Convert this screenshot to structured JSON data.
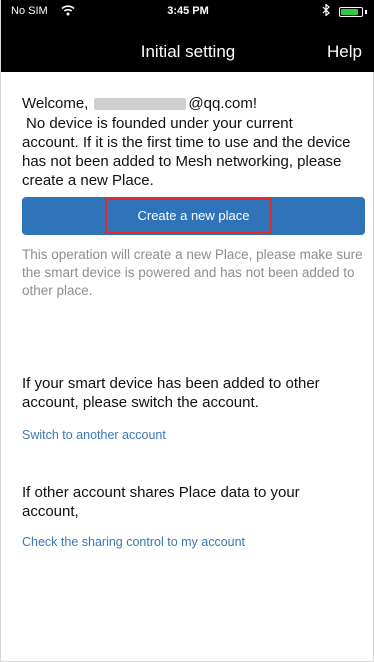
{
  "status_bar": {
    "carrier": "No SIM",
    "time": "3:45 PM",
    "battery_level": 0.85
  },
  "nav": {
    "title": "Initial setting",
    "help_label": "Help"
  },
  "welcome": {
    "prefix": "Welcome,",
    "email_suffix": "@qq.com!"
  },
  "notice": {
    "first_line": "No device is founded under your current",
    "rest": "account. If it is the first time to use and the device has not been added to Mesh networking, please create a new Place."
  },
  "create_button": {
    "label": "Create a new place",
    "color": "#2f73b8"
  },
  "highlight_color": "#e22a2a",
  "operation_description": "This operation will create a new Place, please make sure the smart device is powered and has not been added to other place.",
  "switch_section": {
    "text": "If your smart device has been added to other account, please switch the account.",
    "link_label": "Switch to another account"
  },
  "share_section": {
    "text": "If other account shares Place data to your account,",
    "link_label": "Check the sharing control to my account"
  },
  "icons": [
    "wifi-icon",
    "bluetooth-icon",
    "battery-icon"
  ]
}
